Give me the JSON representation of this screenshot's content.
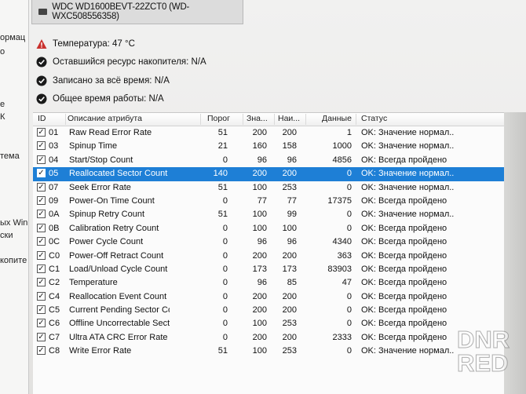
{
  "left_pane": [
    "ормац",
    "о",
    "е",
    "К",
    "тема",
    "ых Win",
    "ски",
    "копите"
  ],
  "drive": {
    "title": "WDC WD1600BEVT-22ZCT0 (WD-WXC508556358)"
  },
  "status": [
    {
      "icon": "warning",
      "text": "Температура: 47 °C"
    },
    {
      "icon": "ok",
      "text": "Оставшийся ресурс накопителя: N/A"
    },
    {
      "icon": "ok",
      "text": "Записано за всё время: N/A"
    },
    {
      "icon": "ok",
      "text": "Общее время работы: N/A"
    }
  ],
  "table": {
    "headers": {
      "id": "ID",
      "desc": "Описание атрибута",
      "thr": "Порог",
      "val": "Зна...",
      "wor": "Наи...",
      "raw": "Данные",
      "st": "Статус"
    },
    "rows": [
      {
        "id": "01",
        "desc": "Raw Read Error Rate",
        "thr": "51",
        "val": "200",
        "wor": "200",
        "raw": "1",
        "st": "OK: Значение нормал..."
      },
      {
        "id": "03",
        "desc": "Spinup Time",
        "thr": "21",
        "val": "160",
        "wor": "158",
        "raw": "1000",
        "st": "OK: Значение нормал..."
      },
      {
        "id": "04",
        "desc": "Start/Stop Count",
        "thr": "0",
        "val": "96",
        "wor": "96",
        "raw": "4856",
        "st": "OK: Всегда пройдено"
      },
      {
        "id": "05",
        "desc": "Reallocated Sector Count",
        "thr": "140",
        "val": "200",
        "wor": "200",
        "raw": "0",
        "st": "OK: Значение нормал..."
      },
      {
        "id": "07",
        "desc": "Seek Error Rate",
        "thr": "51",
        "val": "100",
        "wor": "253",
        "raw": "0",
        "st": "OK: Значение нормал..."
      },
      {
        "id": "09",
        "desc": "Power-On Time Count",
        "thr": "0",
        "val": "77",
        "wor": "77",
        "raw": "17375",
        "st": "OK: Всегда пройдено"
      },
      {
        "id": "0A",
        "desc": "Spinup Retry Count",
        "thr": "51",
        "val": "100",
        "wor": "99",
        "raw": "0",
        "st": "OK: Значение нормал..."
      },
      {
        "id": "0B",
        "desc": "Calibration Retry Count",
        "thr": "0",
        "val": "100",
        "wor": "100",
        "raw": "0",
        "st": "OK: Всегда пройдено"
      },
      {
        "id": "0C",
        "desc": "Power Cycle Count",
        "thr": "0",
        "val": "96",
        "wor": "96",
        "raw": "4340",
        "st": "OK: Всегда пройдено"
      },
      {
        "id": "C0",
        "desc": "Power-Off Retract Count",
        "thr": "0",
        "val": "200",
        "wor": "200",
        "raw": "363",
        "st": "OK: Всегда пройдено"
      },
      {
        "id": "C1",
        "desc": "Load/Unload Cycle Count",
        "thr": "0",
        "val": "173",
        "wor": "173",
        "raw": "83903",
        "st": "OK: Всегда пройдено"
      },
      {
        "id": "C2",
        "desc": "Temperature",
        "thr": "0",
        "val": "96",
        "wor": "85",
        "raw": "47",
        "st": "OK: Всегда пройдено"
      },
      {
        "id": "C4",
        "desc": "Reallocation Event Count",
        "thr": "0",
        "val": "200",
        "wor": "200",
        "raw": "0",
        "st": "OK: Всегда пройдено"
      },
      {
        "id": "C5",
        "desc": "Current Pending Sector Count",
        "thr": "0",
        "val": "200",
        "wor": "200",
        "raw": "0",
        "st": "OK: Всегда пройдено"
      },
      {
        "id": "C6",
        "desc": "Offline Uncorrectable Sector C...",
        "thr": "0",
        "val": "100",
        "wor": "253",
        "raw": "0",
        "st": "OK: Всегда пройдено"
      },
      {
        "id": "C7",
        "desc": "Ultra ATA CRC Error Rate",
        "thr": "0",
        "val": "200",
        "wor": "200",
        "raw": "2333",
        "st": "OK: Всегда пройдено"
      },
      {
        "id": "C8",
        "desc": "Write Error Rate",
        "thr": "51",
        "val": "100",
        "wor": "253",
        "raw": "0",
        "st": "OK: Значение нормал..."
      }
    ],
    "selected_id": "05",
    "selection_color": "#1e7fd6"
  },
  "watermark": "DNR RED"
}
